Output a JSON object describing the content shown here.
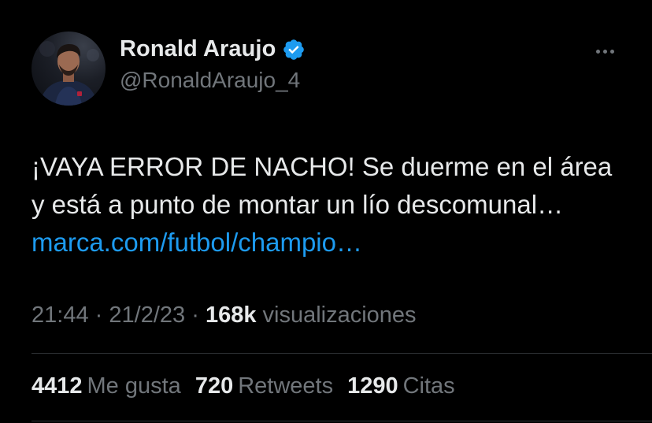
{
  "author": {
    "display_name": "Ronald Araujo",
    "handle": "@RonaldAraujo_4",
    "verified": true,
    "verified_color": "#1d9bf0"
  },
  "tweet": {
    "text_main": "¡VAYA ERROR DE NACHO! Se duerme en el área y está a punto de montar un lío descomunal…",
    "link_text": "marca.com/futbol/champio…"
  },
  "meta": {
    "time": "21:44",
    "separator": "·",
    "date": "21/2/23",
    "views_count": "168k",
    "views_label": "visualizaciones"
  },
  "stats": {
    "likes_count": "4412",
    "likes_label": "Me gusta",
    "retweets_count": "720",
    "retweets_label": "Retweets",
    "quotes_count": "1290",
    "quotes_label": "Citas"
  },
  "icons": {
    "more": "more-horizontal-icon",
    "verified": "verified-badge-icon"
  },
  "colors": {
    "background": "#000000",
    "text_primary": "#e7e9ea",
    "text_secondary": "#71767b",
    "link": "#1d9bf0",
    "divider": "#2f3336"
  }
}
